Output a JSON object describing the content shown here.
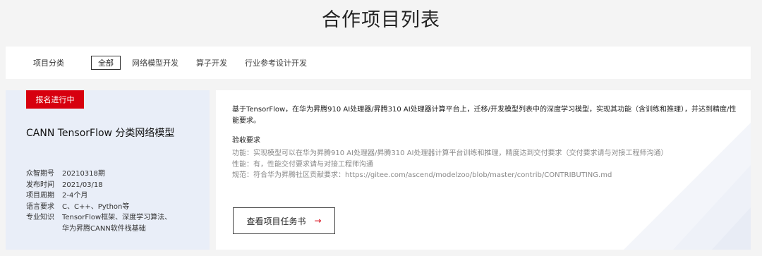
{
  "page": {
    "title": "合作项目列表"
  },
  "filter": {
    "label": "项目分类",
    "tabs": [
      {
        "label": "全部",
        "active": true
      },
      {
        "label": "网络模型开发",
        "active": false
      },
      {
        "label": "算子开发",
        "active": false
      },
      {
        "label": "行业参考设计开发",
        "active": false
      }
    ]
  },
  "project": {
    "status": "报名进行中",
    "status_color": "#d7000f",
    "title": "CANN TensorFlow 分类网络模型",
    "meta": [
      {
        "key": "众智期号",
        "value": "20210318期"
      },
      {
        "key": "发布时间",
        "value": "2021/03/18"
      },
      {
        "key": "项目周期",
        "value": "2-4个月"
      },
      {
        "key": "语言要求",
        "value": "C、C++、Python等"
      },
      {
        "key": "专业知识",
        "value": "TensorFlow框架、深度学习算法、华为昇腾CANN软件栈基础"
      }
    ],
    "description": "基于TensorFlow，在华为昇腾910 AI处理器/昇腾310 AI处理器计算平台上，迁移/开发模型列表中的深度学习模型，实现其功能（含训练和推理），并达到精度/性能要求。",
    "acceptance_title": "验收要求",
    "acceptance": [
      "功能：实现模型可以在华为昇腾910 AI处理器/昇腾310 AI处理器计算平台训练和推理，精度达到交付要求（交付要求请与对接工程师沟通）",
      "性能：有，性能交付要求请与对接工程师沟通",
      "规范：符合华为昇腾社区贡献要求：https://gitee.com/ascend/modelzoo/blob/master/contrib/CONTRIBUTING.md"
    ],
    "button_label": "查看项目任务书",
    "button_icon": "arrow-right-icon"
  }
}
